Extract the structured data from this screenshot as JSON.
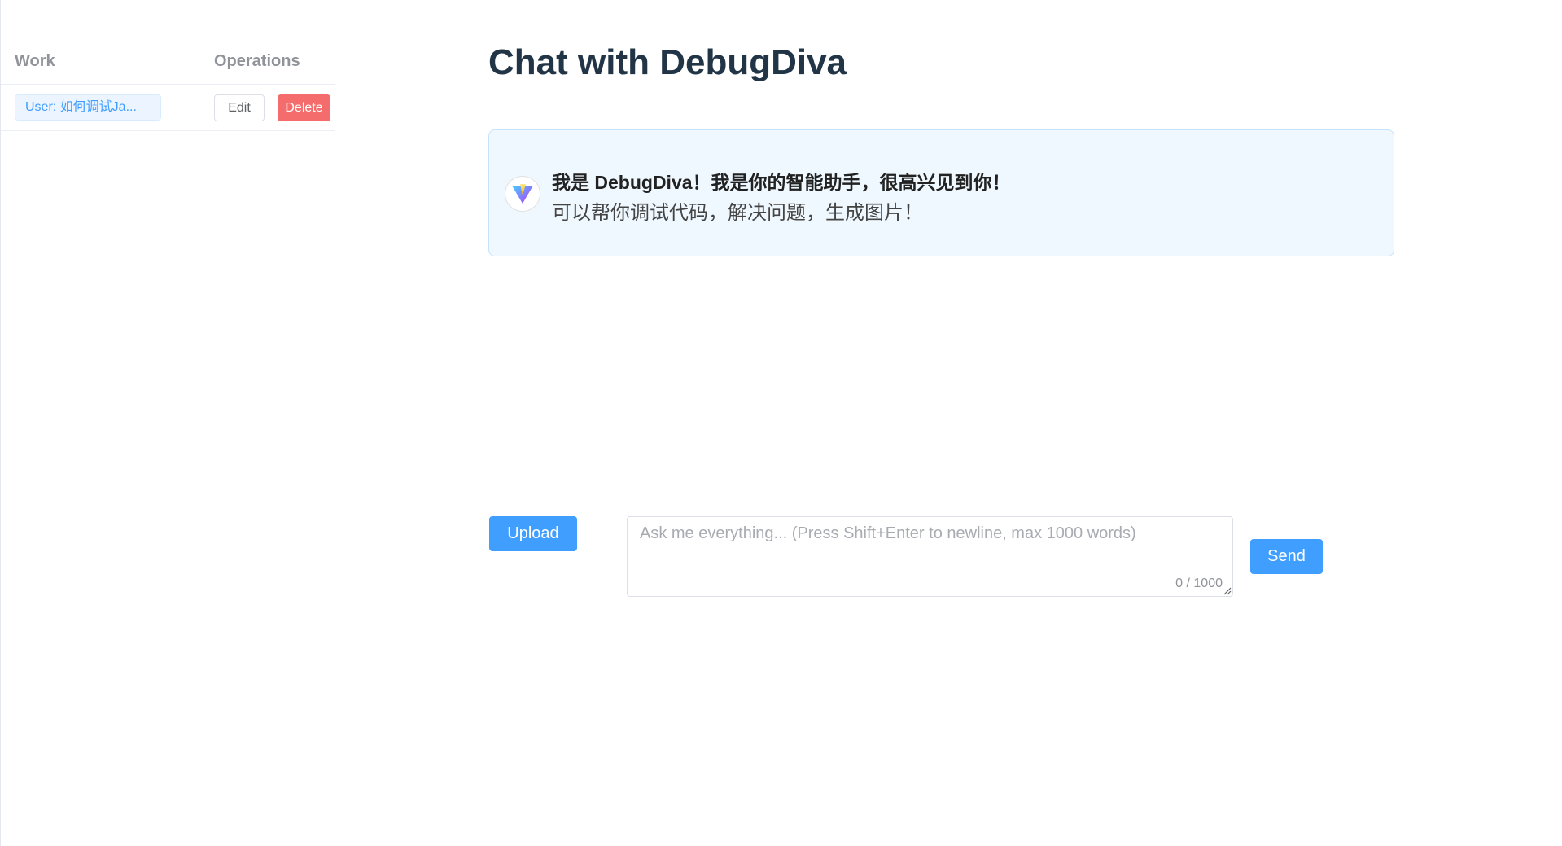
{
  "sidebar": {
    "columns": {
      "work": "Work",
      "operations": "Operations"
    },
    "rows": [
      {
        "title": "User: 如何调试Ja...",
        "edit_label": "Edit",
        "delete_label": "Delete"
      }
    ]
  },
  "main": {
    "title": "Chat with DebugDiva",
    "welcome": {
      "line1": "我是 DebugDiva！我是你的智能助手，很高兴见到你！",
      "line2": "可以帮你调试代码，解决问题，生成图片！",
      "avatar_icon": "vite-logo-icon"
    },
    "composer": {
      "upload_label": "Upload",
      "placeholder": "Ask me everything... (Press Shift+Enter to newline, max 1000 words)",
      "value": "",
      "counter": "0 / 1000",
      "send_label": "Send"
    }
  },
  "colors": {
    "primary": "#409eff",
    "danger": "#f56c6c",
    "title": "#213547",
    "card_bg": "#eff8fe"
  }
}
